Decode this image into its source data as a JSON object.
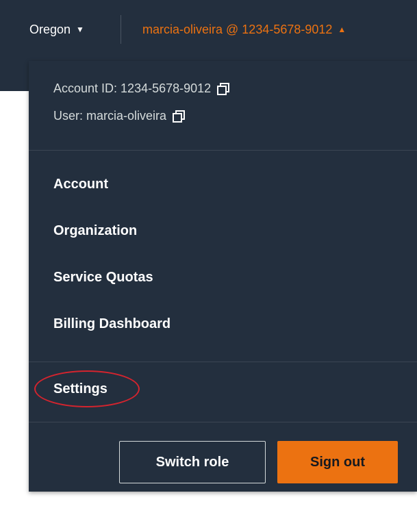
{
  "header": {
    "region_label": "Oregon",
    "account_label": "marcia-oliveira @ 1234-5678-9012"
  },
  "account_info": {
    "account_id_label": "Account ID: 1234-5678-9012",
    "user_label": "User: marcia-oliveira"
  },
  "menu": {
    "items": [
      {
        "label": "Account"
      },
      {
        "label": "Organization"
      },
      {
        "label": "Service Quotas"
      },
      {
        "label": "Billing Dashboard"
      }
    ],
    "settings_label": "Settings"
  },
  "actions": {
    "switch_role_label": "Switch role",
    "sign_out_label": "Sign out"
  },
  "icons": {
    "region_caret": "caret-down-icon",
    "account_caret": "caret-up-icon",
    "copy": "copy-icon"
  },
  "colors": {
    "navbar_bg": "#232f3e",
    "accent_orange": "#ec7211",
    "highlight_circle": "#d4242e"
  }
}
